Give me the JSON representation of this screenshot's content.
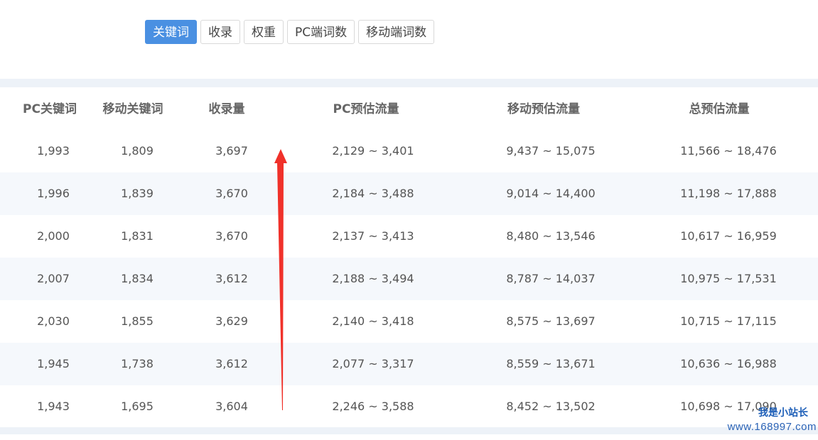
{
  "tabs": [
    {
      "label": "关键词",
      "active": true
    },
    {
      "label": "收录",
      "active": false
    },
    {
      "label": "权重",
      "active": false
    },
    {
      "label": "PC端词数",
      "active": false
    },
    {
      "label": "移动端词数",
      "active": false
    }
  ],
  "table": {
    "headers": [
      "PC关键词",
      "移动关键词",
      "收录量",
      "PC预估流量",
      "移动预估流量",
      "总预估流量"
    ],
    "rows": [
      [
        "1,993",
        "1,809",
        "3,697",
        "2,129 ~ 3,401",
        "9,437 ~ 15,075",
        "11,566 ~ 18,476"
      ],
      [
        "1,996",
        "1,839",
        "3,670",
        "2,184 ~ 3,488",
        "9,014 ~ 14,400",
        "11,198 ~ 17,888"
      ],
      [
        "2,000",
        "1,831",
        "3,670",
        "2,137 ~ 3,413",
        "8,480 ~ 13,546",
        "10,617 ~ 16,959"
      ],
      [
        "2,007",
        "1,834",
        "3,612",
        "2,188 ~ 3,494",
        "8,787 ~ 14,037",
        "10,975 ~ 17,531"
      ],
      [
        "2,030",
        "1,855",
        "3,629",
        "2,140 ~ 3,418",
        "8,575 ~ 13,697",
        "10,715 ~ 17,115"
      ],
      [
        "1,945",
        "1,738",
        "3,612",
        "2,077 ~ 3,317",
        "8,559 ~ 13,671",
        "10,636 ~ 16,988"
      ],
      [
        "1,943",
        "1,695",
        "3,604",
        "2,246 ~ 3,588",
        "8,452 ~ 13,502",
        "10,698 ~ 17,090"
      ]
    ]
  },
  "watermark": {
    "text": "我是小站长",
    "url": "www.168997.com"
  },
  "colors": {
    "accent": "#4a90e2",
    "arrow": "#f0312a",
    "stripe": "#f5f8fc",
    "band": "#edf2f8"
  }
}
